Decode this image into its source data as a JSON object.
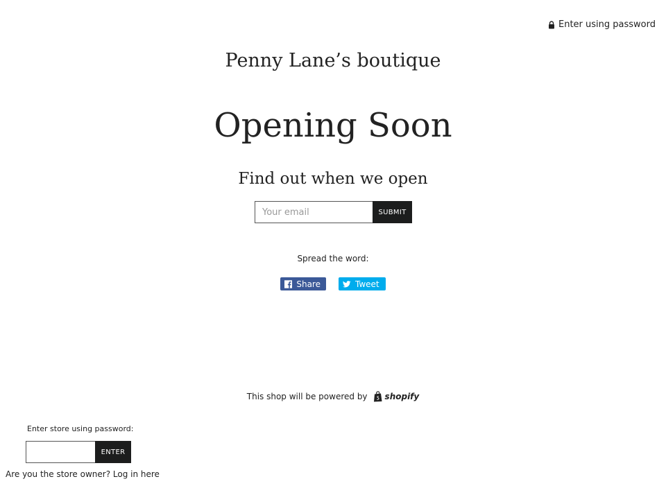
{
  "header": {
    "enter_password_label": "Enter using password",
    "lock_icon": "lock-icon"
  },
  "main": {
    "shop_name": "Penny Lane’s boutique",
    "headline": "Opening Soon",
    "subheadline": "Find out when we open",
    "signup": {
      "email_value": "",
      "email_placeholder": "Your email",
      "submit_label": "SUBMIT"
    },
    "social": {
      "label": "Spread the word:",
      "facebook": {
        "label": "Share",
        "icon": "facebook-icon",
        "color": "#3b5998"
      },
      "twitter": {
        "label": "Tweet",
        "icon": "twitter-icon",
        "color": "#00aced"
      }
    }
  },
  "footer": {
    "powered_by_text": "This shop will be powered by",
    "shopify_label": "shopify",
    "password_form": {
      "label": "Enter store using password:",
      "password_value": "",
      "enter_label": "ENTER"
    },
    "owner_prompt": "Are you the store owner?",
    "login_link": "Log in here"
  },
  "colors": {
    "button_dark": "#1c1d1d",
    "text": "#222222",
    "background": "#ffffff"
  }
}
